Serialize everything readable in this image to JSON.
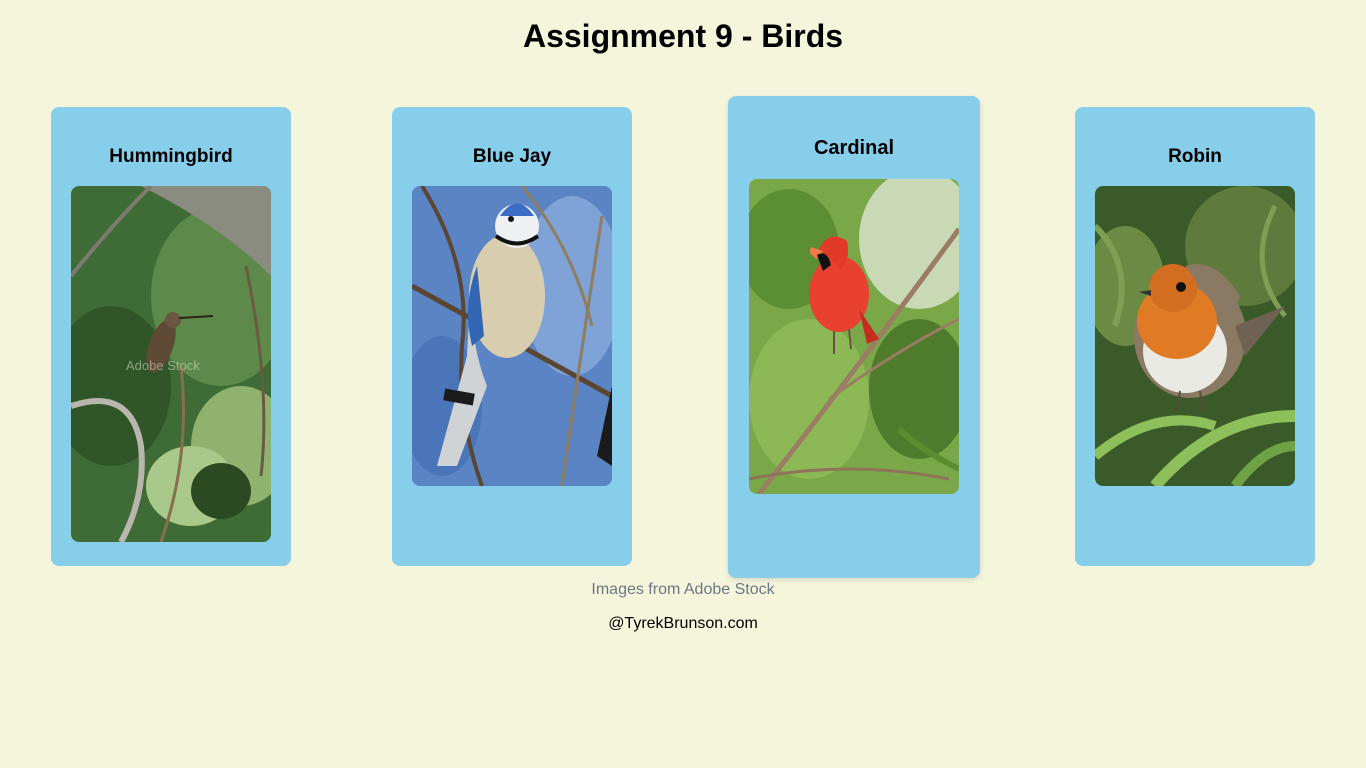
{
  "page": {
    "title": "Assignment 9 - Birds"
  },
  "cards": [
    {
      "name": "Hummingbird",
      "watermark": "Adobe Stock"
    },
    {
      "name": "Blue Jay"
    },
    {
      "name": "Cardinal"
    },
    {
      "name": "Robin"
    }
  ],
  "footer": {
    "credit": "Images from Adobe Stock",
    "site": "@TyrekBrunson.com"
  },
  "colors": {
    "background": "#f5f5dc",
    "card": "#87ceeb",
    "credit_text": "#6b7783"
  }
}
